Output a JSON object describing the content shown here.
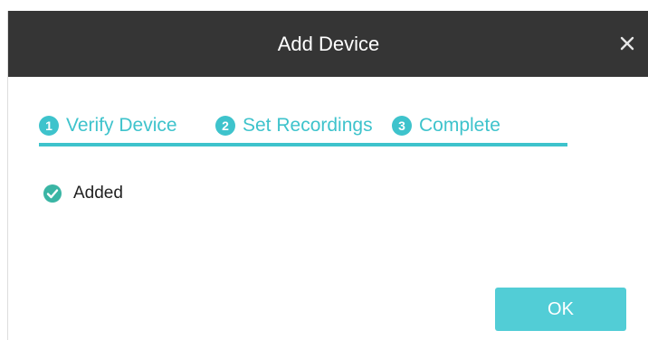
{
  "dialog": {
    "title": "Add Device",
    "close_icon": "close-icon"
  },
  "steps": [
    {
      "number": "1",
      "label": "Verify Device"
    },
    {
      "number": "2",
      "label": "Set Recordings"
    },
    {
      "number": "3",
      "label": "Complete"
    }
  ],
  "status": {
    "icon": "check-circle-icon",
    "text": "Added"
  },
  "actions": {
    "ok_label": "OK"
  },
  "colors": {
    "titlebar": "#353535",
    "accent": "#3ec3cc",
    "ok_button": "#52cdd6",
    "success": "#3ab5a4"
  }
}
